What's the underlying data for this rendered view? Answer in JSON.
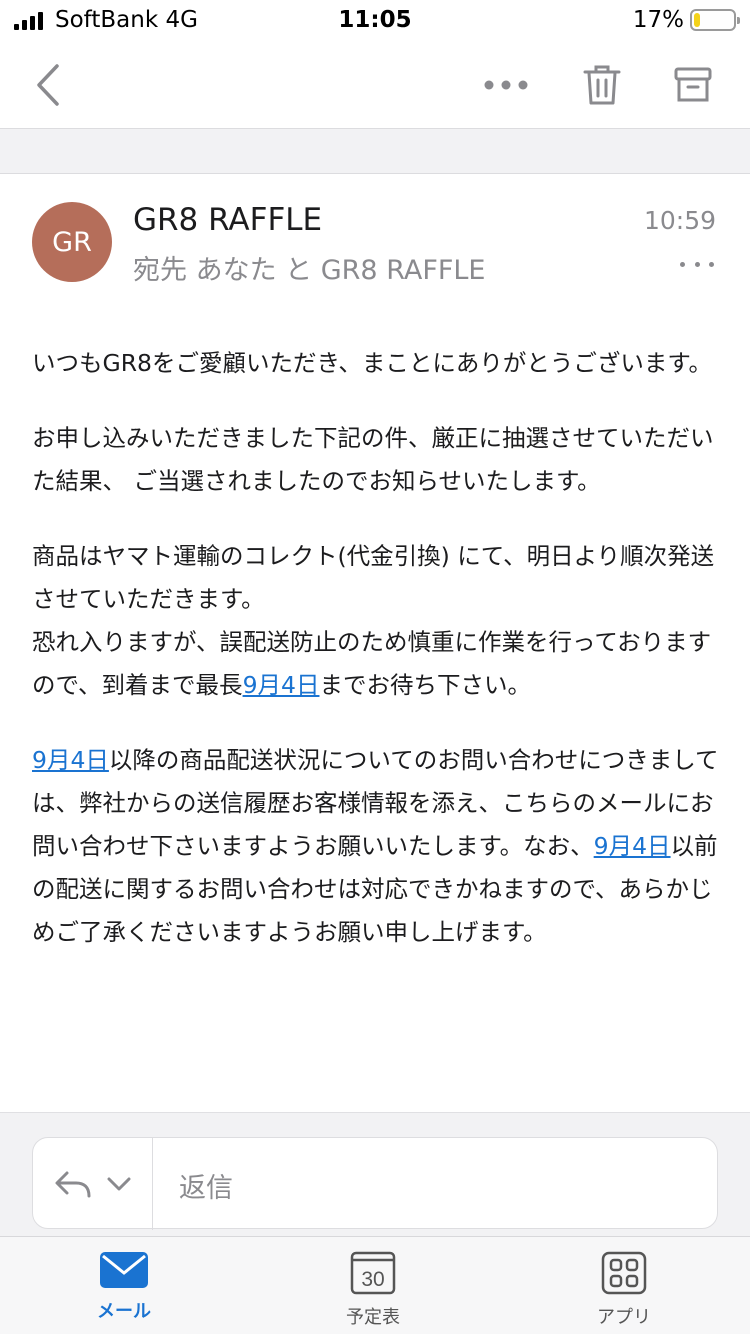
{
  "status_bar": {
    "carrier": "SoftBank  4G",
    "time": "11:05",
    "battery_percent_text": "17%",
    "battery_level": 0.17
  },
  "toolbar": {
    "back_icon": "chevron-left-icon",
    "more_icon": "more-horizontal-icon",
    "trash_icon": "trash-icon",
    "archive_icon": "archive-icon"
  },
  "message": {
    "avatar_initials": "GR",
    "avatar_color": "#b56e5a",
    "sender": "GR8 RAFFLE",
    "recipients": "宛先 あなた と GR8 RAFFLE",
    "time": "10:59"
  },
  "body": {
    "p1": "いつもGR8をご愛顧いただき、まことにありがとうございます。",
    "p2": "お申し込みいただきました下記の件、厳正に抽選させていただいた結果、 ご当選されましたのでお知らせいたします。",
    "p3_line1": "商品はヤマト運輸のコレクト(代金引換) にて、明日より順次発送させていただきます。",
    "p3_line2_before": "恐れ入りますが、誤配送防止のため慎重に作業を行っておりますので、到着まで最長",
    "p3_link": "9月4日",
    "p3_line2_after": "までお待ち下さい。",
    "p4_link1": "9月4日",
    "p4_text1": "以降の商品配送状況についてのお問い合わせにつきましては、弊社からの送信履歴お客様情報を添え、こちらのメールにお問い合わせ下さいますようお願いいたします。なお、",
    "p4_link2": "9月4日",
    "p4_text2": "以前の配送に関するお問い合わせは対応できかねますので、あらかじめご了承くださいますようお願い申し上げます。"
  },
  "reply": {
    "label": "返信",
    "link_color": "#1a73d1"
  },
  "tabs": [
    {
      "label": "メール",
      "icon": "mail-icon",
      "active": true
    },
    {
      "label": "予定表",
      "icon": "calendar-icon",
      "calendar_day": "30",
      "active": false
    },
    {
      "label": "アプリ",
      "icon": "apps-grid-icon",
      "active": false
    }
  ]
}
